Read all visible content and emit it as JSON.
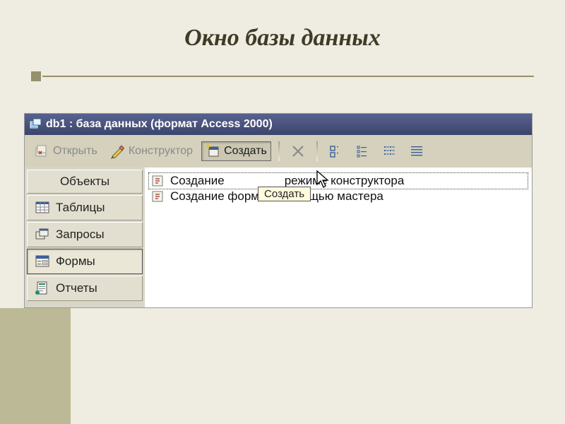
{
  "slide": {
    "title": "Окно базы данных"
  },
  "window": {
    "title": "db1 : база данных (формат Access 2000)"
  },
  "toolbar": {
    "open": "Открыть",
    "design": "Конструктор",
    "create": "Создать"
  },
  "sidebar": {
    "header": "Объекты",
    "items": [
      {
        "label": "Таблицы"
      },
      {
        "label": "Запросы"
      },
      {
        "label": "Формы",
        "selected": true
      },
      {
        "label": "Отчеты"
      }
    ]
  },
  "main": {
    "items": [
      {
        "part1": "Создание",
        "part2": "режиме конструктора",
        "selected": true
      },
      {
        "label": "Создание формы с помощью мастера"
      }
    ]
  },
  "tooltip": {
    "text": "Создать"
  }
}
